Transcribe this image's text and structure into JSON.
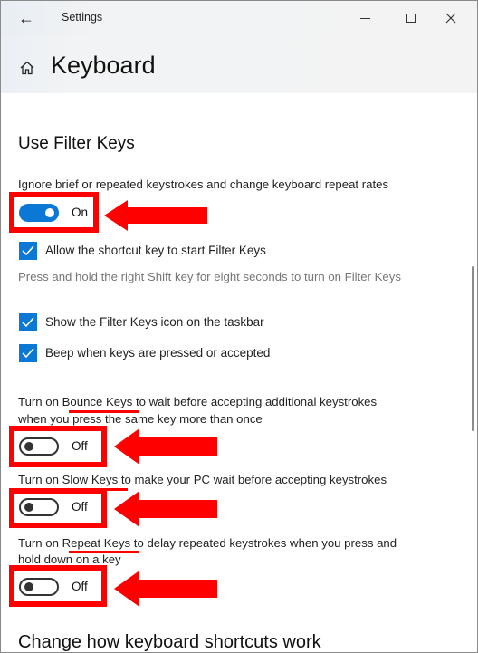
{
  "window": {
    "title": "Settings",
    "back_icon": "back-arrow-icon",
    "controls": [
      "minimize-icon",
      "maximize-icon",
      "close-icon"
    ]
  },
  "header": {
    "home_icon": "home-icon",
    "title": "Keyboard"
  },
  "filter_keys": {
    "section_title": "Use Filter Keys",
    "main_toggle": {
      "description": "Ignore brief or repeated keystrokes and change keyboard repeat rates",
      "state": "On"
    },
    "checkboxes": [
      {
        "label": "Allow the shortcut key to start Filter Keys",
        "checked": true
      },
      {
        "label": "Show the Filter Keys icon on the taskbar",
        "checked": true
      },
      {
        "label": "Beep when keys are pressed or accepted",
        "checked": true
      }
    ],
    "shortcut_hint": "Press and hold the right Shift key for eight seconds to turn on Filter Keys",
    "bounce_keys": {
      "description_line1": "Turn on Bounce Keys to wait before accepting additional keystrokes",
      "description_line2": "when you press the same key more than once",
      "state": "Off"
    },
    "slow_keys": {
      "description": "Turn on Slow Keys to make your PC wait before accepting keystrokes",
      "state": "Off"
    },
    "repeat_keys": {
      "description_line1": "Turn on Repeat Keys to delay repeated keystrokes when you press and",
      "description_line2": "hold down on a key",
      "state": "Off"
    }
  },
  "next_section": {
    "title": "Change how keyboard shortcuts work"
  },
  "annotations": {
    "highlight_color": "#ff0000",
    "accent_color": "#0a78d4"
  }
}
